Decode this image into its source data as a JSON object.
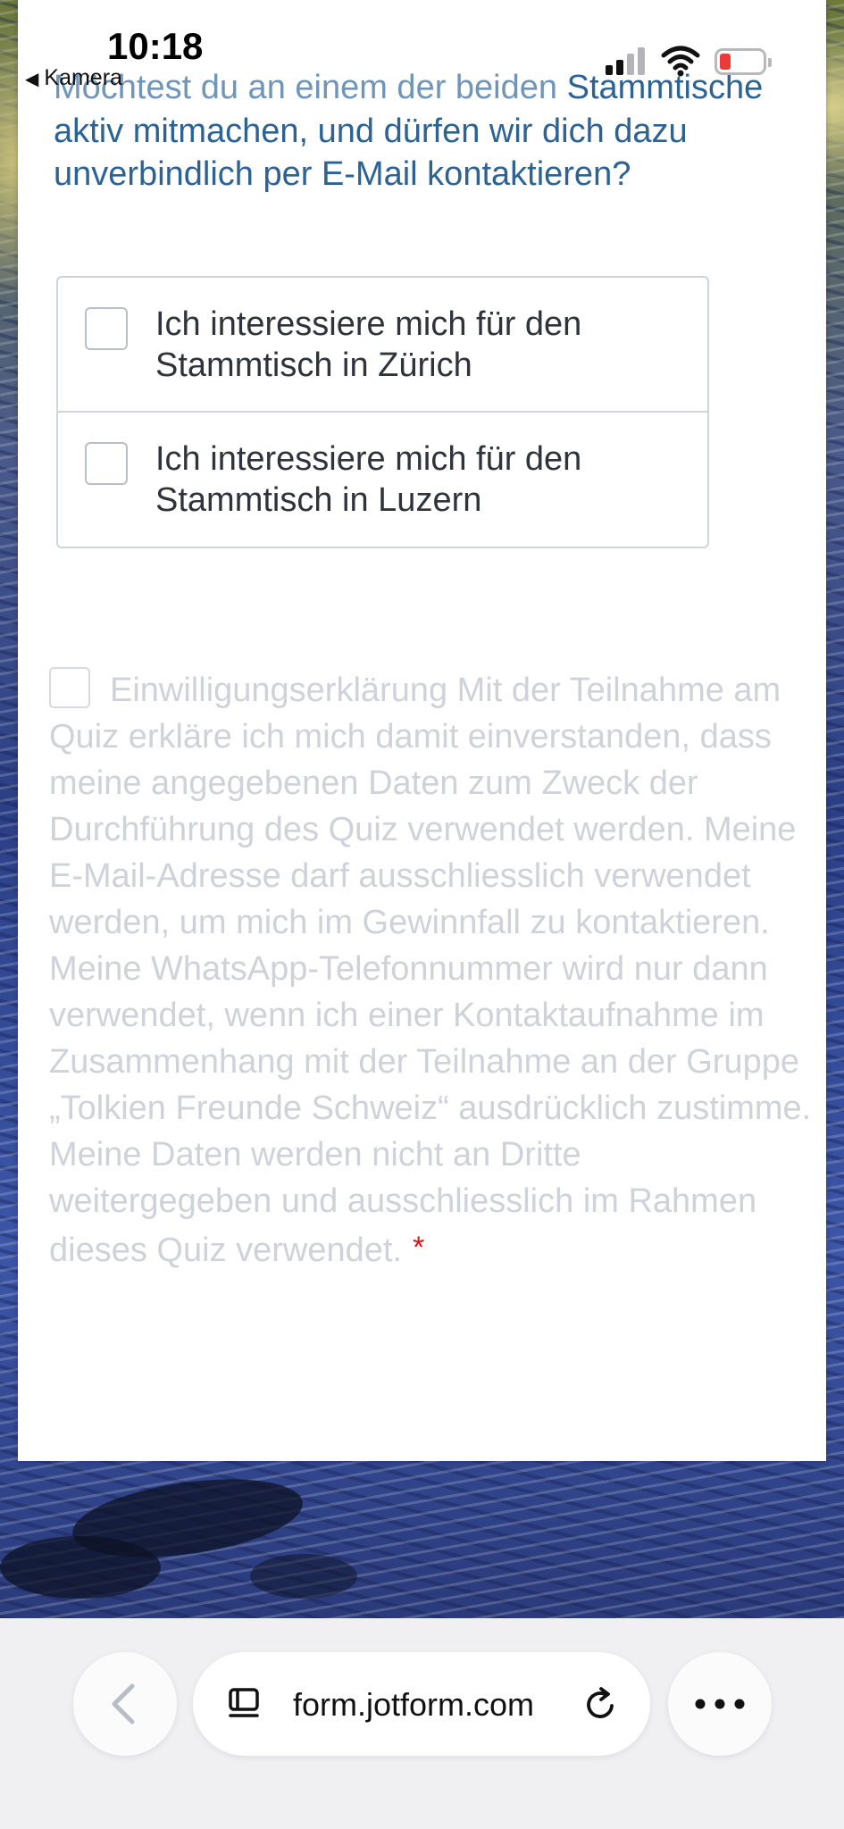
{
  "status_bar": {
    "time": "10:18",
    "back_app": "Kamera",
    "back_icon": "back-triangle-icon",
    "battery_color": "#ea3a3a"
  },
  "form": {
    "question_faded": "Möchtest du an einem der beiden",
    "question_rest": "Stammtische aktiv mitmachen, und dürfen wir dich dazu unverbindlich per E-Mail kontaktieren?",
    "question_color": "#2d6295",
    "options": [
      {
        "label": "Ich interessiere mich für den Stammtisch in Zürich",
        "checked": false
      },
      {
        "label": "Ich interessiere mich für den Stammtisch in Luzern",
        "checked": false
      }
    ],
    "consent": {
      "text": "Einwilligungserklärung Mit der Teilnahme am Quiz erkläre ich mich damit einverstanden, dass meine angegebenen Daten zum Zweck der Durchführung des Quiz verwendet werden. Meine E-Mail-Adresse darf ausschliesslich verwendet werden, um mich im Gewinnfall zu kontaktieren. Meine WhatsApp-Telefonnummer wird nur dann verwendet, wenn ich einer Kontaktaufnahme im Zusammenhang mit der Teilnahme an der Gruppe „Tolkien Freunde Schweiz“ ausdrücklich zustimme. Meine Daten werden nicht an Dritte weitergegeben und ausschliesslich im Rahmen dieses Quiz verwendet.",
      "required_mark": "*",
      "checked": false
    }
  },
  "browser": {
    "url": "form.jotform.com",
    "icons": {
      "back": "chevron-left-icon",
      "page": "page-menu-icon",
      "reload": "reload-icon",
      "more": "more-icon"
    }
  }
}
